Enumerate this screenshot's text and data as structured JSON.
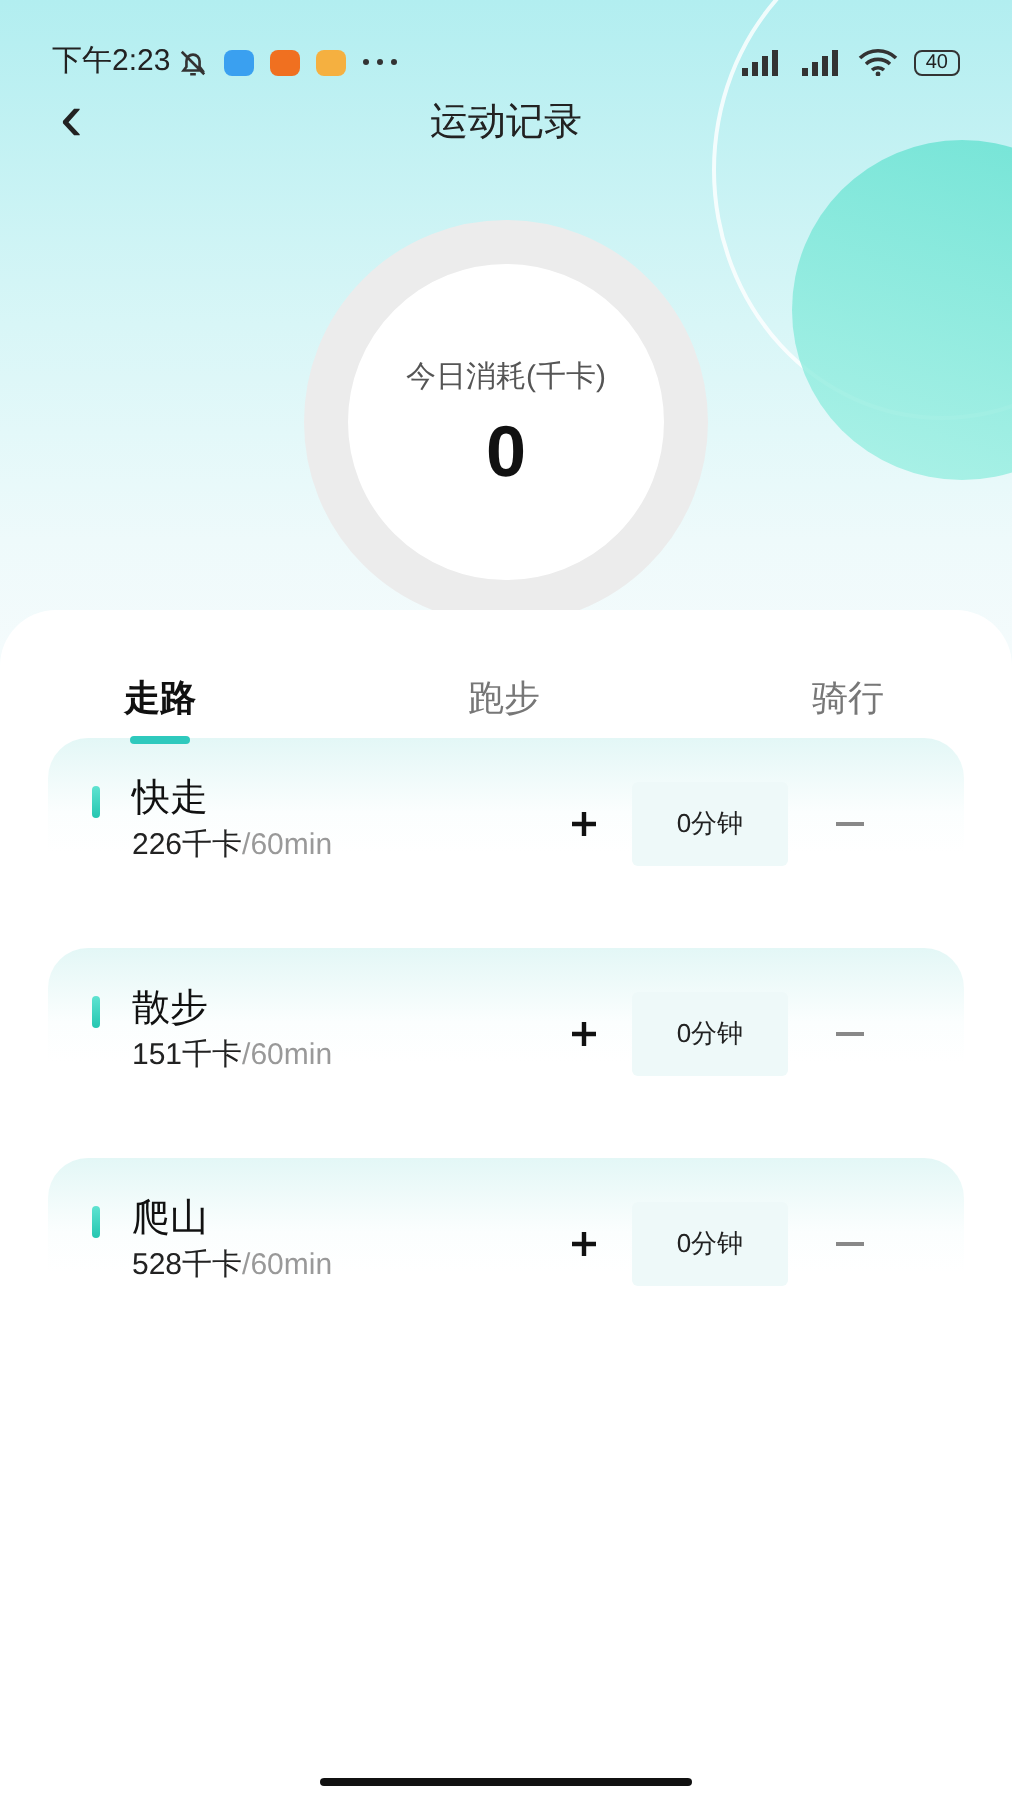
{
  "status_bar": {
    "time": "下午2:23",
    "battery": "40"
  },
  "header": {
    "back": "‹",
    "title": "运动记录"
  },
  "summary": {
    "label": "今日消耗(千卡)",
    "value": "0"
  },
  "tabs": [
    {
      "label": "走路",
      "selected": true
    },
    {
      "label": "跑步",
      "selected": false
    },
    {
      "label": "骑行",
      "selected": false
    }
  ],
  "activities": [
    {
      "name": "快走",
      "calories": "226千卡",
      "per": "/60min",
      "duration": "0分钟"
    },
    {
      "name": "散步",
      "calories": "151千卡",
      "per": "/60min",
      "duration": "0分钟"
    },
    {
      "name": "爬山",
      "calories": "528千卡",
      "per": "/60min",
      "duration": "0分钟"
    }
  ]
}
